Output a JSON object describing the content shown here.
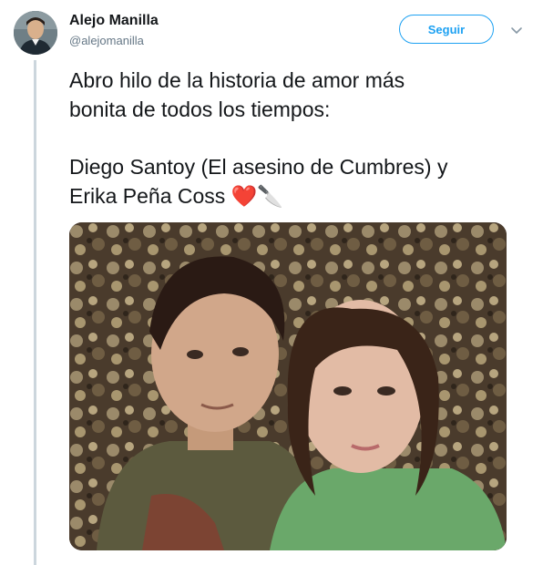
{
  "user": {
    "name": "Alejo Manilla",
    "handle": "@alejomanilla",
    "avatar_icon": "avatar-photo"
  },
  "header": {
    "follow_label": "Seguir",
    "caret_icon": "chevron-down-icon",
    "accent_color": "#1da1f2"
  },
  "tweet": {
    "line1": "Abro hilo de la historia de amor más",
    "line2": "bonita de todos los tiempos:",
    "line3": "Diego Santoy (El asesino de Cumbres) y",
    "line4": "Erika Peña Coss",
    "emojis": [
      {
        "glyph": "❤️",
        "icon": "red-heart-emoji"
      },
      {
        "glyph": "🔪",
        "icon": "knife-emoji"
      }
    ]
  },
  "media": {
    "type": "photo",
    "icon": "couple-photo"
  }
}
